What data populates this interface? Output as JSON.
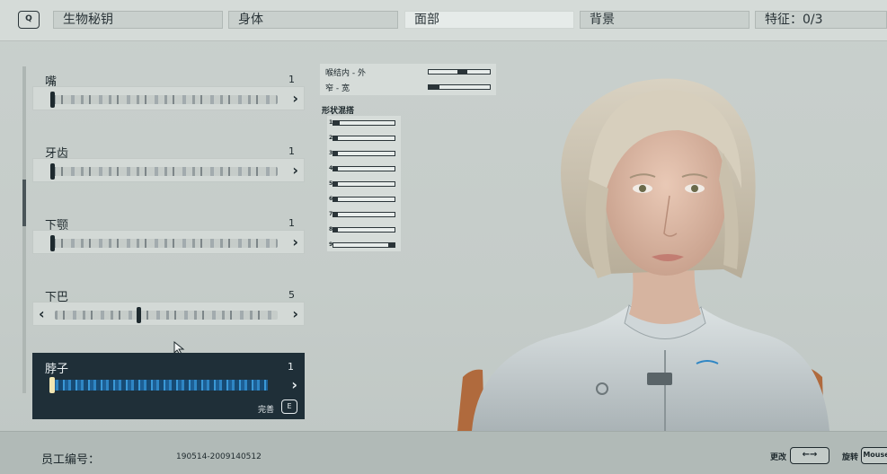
{
  "topbar": {
    "key_hint": "Q",
    "tabs": [
      {
        "label": "生物秘钥"
      },
      {
        "label": "身体"
      },
      {
        "label": "面部"
      },
      {
        "label": "背景"
      },
      {
        "label": "特征：0/3"
      }
    ]
  },
  "features": [
    {
      "label": "嘴",
      "count": "1"
    },
    {
      "label": "牙齿",
      "count": "1"
    },
    {
      "label": "下颚",
      "count": "1"
    },
    {
      "label": "下巴",
      "count": "5"
    },
    {
      "label": "脖子",
      "count": "1",
      "selected": true
    }
  ],
  "selected_panel": {
    "done_label": "完善",
    "done_key": "E"
  },
  "sliders": [
    {
      "label": "喉结内 - 外",
      "value": 0.55
    },
    {
      "label": "窄 - 宽",
      "value": 0.08
    }
  ],
  "shape_blend": {
    "title": "形状混搭",
    "rows": [
      {
        "num": "1",
        "value": 0.1
      },
      {
        "num": "2",
        "value": 0.08
      },
      {
        "num": "3",
        "value": 0.08
      },
      {
        "num": "4",
        "value": 0.08
      },
      {
        "num": "5",
        "value": 0.08
      },
      {
        "num": "6",
        "value": 0.08
      },
      {
        "num": "7",
        "value": 0.08
      },
      {
        "num": "8",
        "value": 0.08
      },
      {
        "num": "9",
        "value": 0.9
      }
    ]
  },
  "bottom": {
    "employee_label": "员工编号：",
    "employee_id": "190514-2009140512",
    "change_label": "更改",
    "change_key": "←→",
    "rotate_label": "旋转",
    "rotate_key": "Mouse"
  },
  "colors": {
    "selected_bg": "#1f2f38",
    "accent_blue": "#2f86c4"
  }
}
